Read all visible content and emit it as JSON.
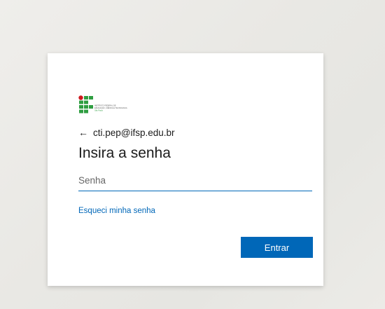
{
  "logo": {
    "name": "IFSP logo",
    "text_lines": [
      "INSTITUTO FEDERAL DE",
      "EDUCAÇÃO, CIÊNCIA E TECNOLOGIA",
      "São Paulo"
    ],
    "colors": {
      "green": "#2f9e41",
      "red": "#cd191e"
    }
  },
  "identity": {
    "back_icon": "←",
    "email": "cti.pep@ifsp.edu.br"
  },
  "title": "Insira a senha",
  "password": {
    "placeholder": "Senha",
    "value": ""
  },
  "forgot_link": "Esqueci minha senha",
  "submit_label": "Entrar",
  "colors": {
    "accent": "#0067b8",
    "text": "#1b1b1b",
    "card": "#ffffff"
  }
}
